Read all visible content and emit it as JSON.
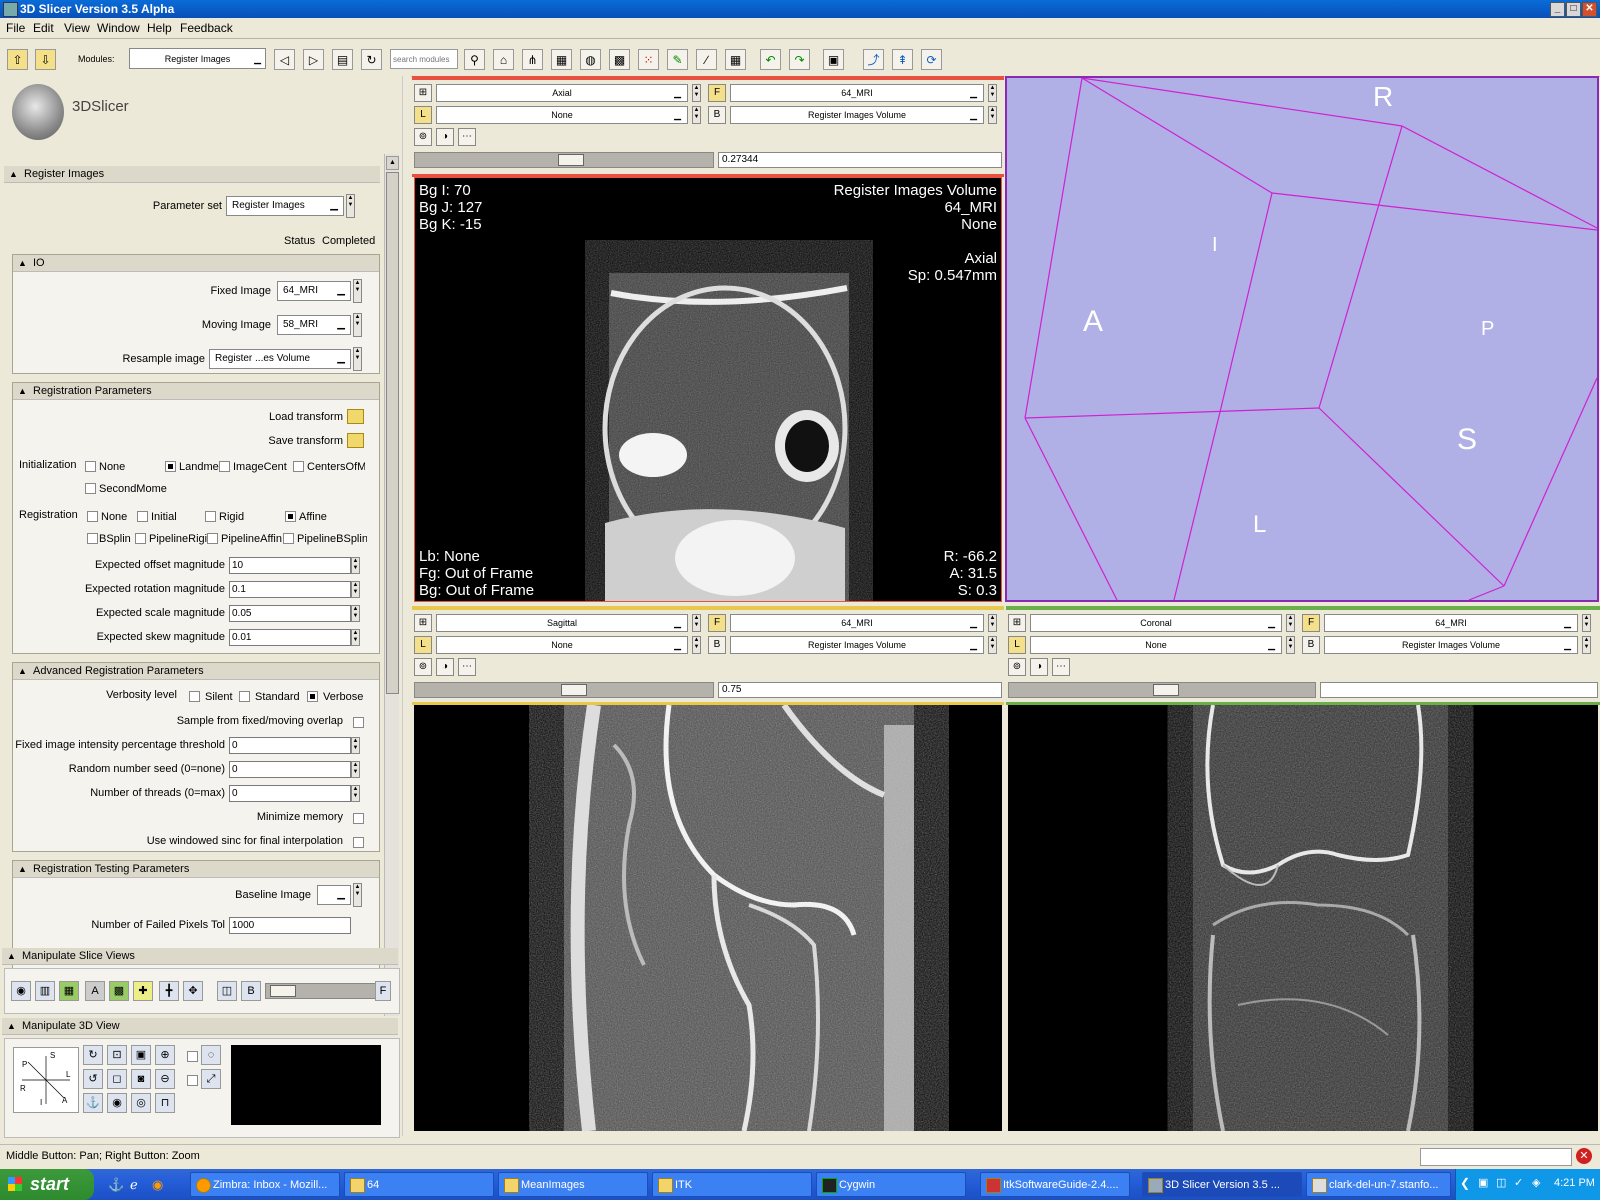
{
  "window": {
    "title": "3D Slicer Version 3.5 Alpha",
    "min": "_",
    "max": "□",
    "close": "✕"
  },
  "menu": [
    "File",
    "Edit",
    "View",
    "Window",
    "Help",
    "Feedback"
  ],
  "toolbar": {
    "modules_label": "Modules:",
    "module_selected": "Register Images",
    "search_placeholder": "search modules"
  },
  "logo": {
    "text": "3DSlicer"
  },
  "register": {
    "section_title": "Register Images",
    "parameter_set_label": "Parameter set",
    "parameter_set_value": "Register Images",
    "status_label": "Status",
    "status_value": "Completed",
    "io": {
      "title": "IO",
      "fixed_label": "Fixed Image",
      "fixed_value": "64_MRI",
      "moving_label": "Moving Image",
      "moving_value": "58_MRI",
      "resample_label": "Resample image",
      "resample_value": "Register ...es Volume"
    },
    "regparams": {
      "title": "Registration Parameters",
      "load_transform": "Load transform",
      "save_transform": "Save transform",
      "init_label": "Initialization",
      "init_options": [
        "None",
        "Landme",
        "ImageCent",
        "CentersOfMa",
        "SecondMome"
      ],
      "init_selected": "Landme",
      "reg_label": "Registration",
      "reg_options": [
        "None",
        "Initial",
        "Rigid",
        "Affine",
        "BSplin",
        "PipelineRigi",
        "PipelineAffin",
        "PipelineBSplin"
      ],
      "reg_selected": "Affine",
      "offset_label": "Expected offset magnitude",
      "offset_value": "10",
      "rotation_label": "Expected rotation magnitude",
      "rotation_value": "0.1",
      "scale_label": "Expected scale magnitude",
      "scale_value": "0.05",
      "skew_label": "Expected skew magnitude",
      "skew_value": "0.01"
    },
    "advanced": {
      "title": "Advanced Registration Parameters",
      "verbosity_label": "Verbosity level",
      "verbosity_options": [
        "Silent",
        "Standard",
        "Verbose"
      ],
      "verbosity_selected": "Verbose",
      "sample_overlap_label": "Sample from fixed/moving overlap",
      "threshold_label": "Fixed image intensity percentage threshold",
      "threshold_value": "0",
      "seed_label": "Random number seed (0=none)",
      "seed_value": "0",
      "threads_label": "Number of threads (0=max)",
      "threads_value": "0",
      "minimize_label": "Minimize memory",
      "sinc_label": "Use windowed sinc for final interpolation"
    },
    "testing": {
      "title": "Registration Testing Parameters",
      "baseline_label": "Baseline Image",
      "failed_pixel_label": "Number of Failed Pixels Tol",
      "failed_pixel_value": "1000"
    }
  },
  "manipulate_slice": {
    "title": "Manipulate Slice Views"
  },
  "manipulate_3d": {
    "title": "Manipulate 3D View",
    "orient": {
      "s": "S",
      "p": "P",
      "l": "L",
      "r": "R",
      "i": "I",
      "a": "A"
    }
  },
  "viewers": {
    "red": {
      "orientation": "Axial",
      "fg": "64_MRI",
      "label": "None",
      "bg": "Register Images Volume",
      "offset": "0.27344",
      "overlay": {
        "tl": [
          "Bg I: 70",
          "Bg J: 127",
          "Bg K: -15"
        ],
        "tr": [
          "Register Images Volume",
          "64_MRI",
          "None",
          "",
          "Axial",
          "Sp: 0.547mm"
        ],
        "bl": [
          "Lb: None",
          "Fg: Out of Frame",
          "Bg: Out of Frame"
        ],
        "br": [
          "R: -66.2",
          "A: 31.5",
          "S: 0.3"
        ]
      }
    },
    "yellow": {
      "orientation": "Sagittal",
      "fg": "64_MRI",
      "label": "None",
      "bg": "Register Images Volume",
      "offset": "0.75"
    },
    "green": {
      "orientation": "Coronal",
      "fg": "64_MRI",
      "label": "None",
      "bg": "Register Images Volume",
      "offset": ""
    },
    "threed": {
      "labels": {
        "r": "R",
        "i": "I",
        "a": "A",
        "p": "P",
        "s": "S",
        "l": "L"
      },
      "bg_color": "#b0b0e6",
      "line_color": "#d020d0"
    }
  },
  "statusbar": {
    "text": "Middle Button: Pan; Right Button: Zoom"
  },
  "taskbar": {
    "start": "start",
    "tasks": [
      "Zimbra: Inbox - Mozill...",
      "64",
      "MeanImages",
      "ITK",
      "Cygwin",
      "ItkSoftwareGuide-2.4....",
      "3D Slicer Version 3.5 ...",
      "clark-del-un-7.stanfo..."
    ],
    "active_task": "3D Slicer Version 3.5 ...",
    "clock": "4:21 PM"
  }
}
